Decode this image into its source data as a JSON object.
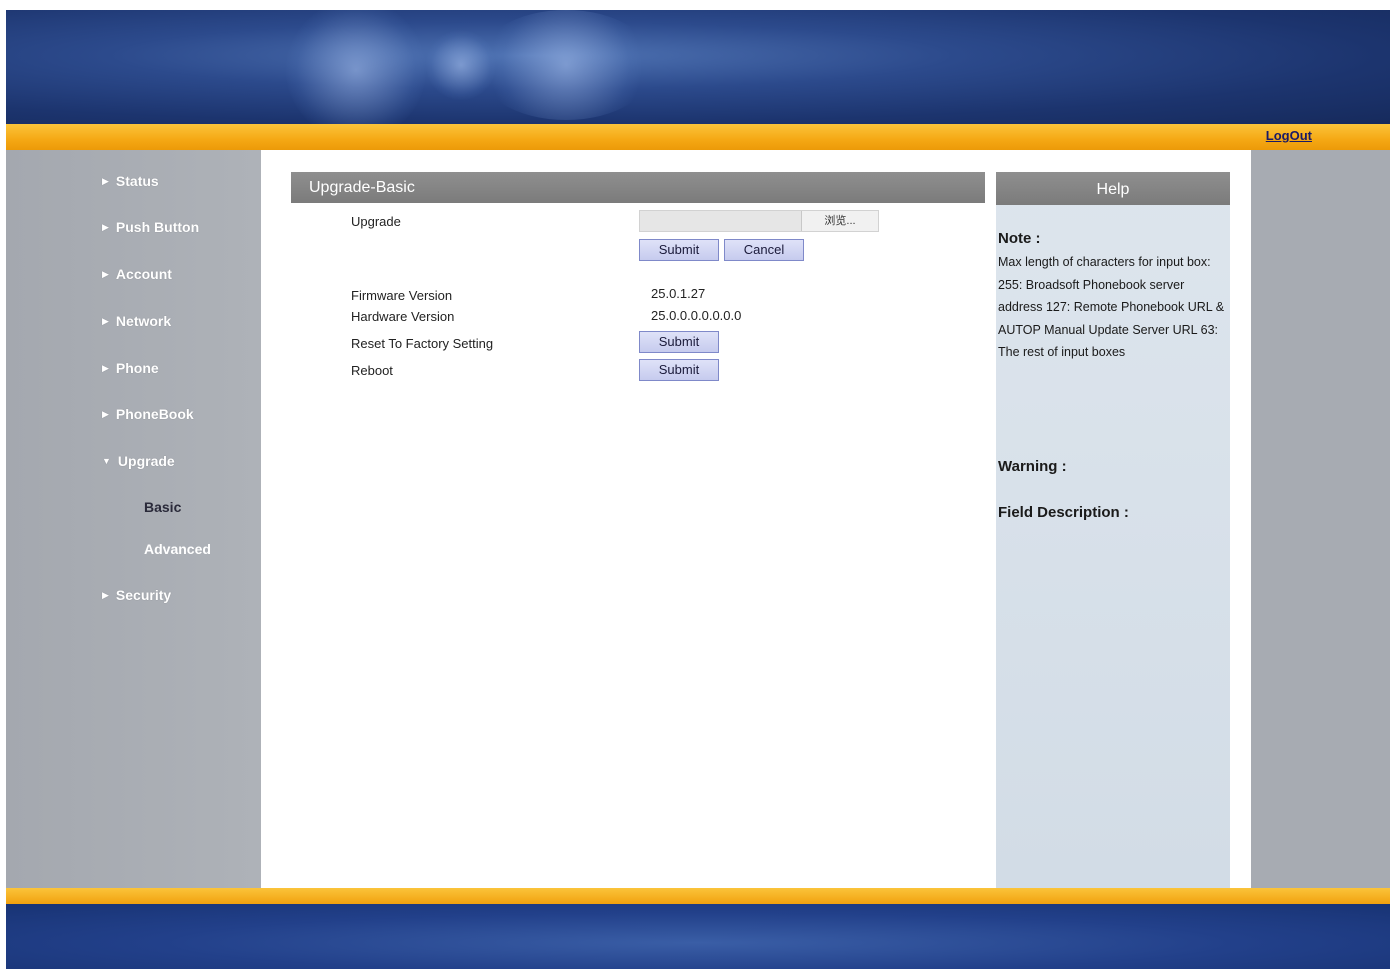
{
  "header": {
    "logout_label": "LogOut"
  },
  "sidebar": {
    "items": [
      {
        "label": "Status"
      },
      {
        "label": "Push Button"
      },
      {
        "label": "Account"
      },
      {
        "label": "Network"
      },
      {
        "label": "Phone"
      },
      {
        "label": "PhoneBook"
      },
      {
        "label": "Upgrade",
        "expanded": true
      },
      {
        "label": "Security"
      }
    ],
    "sub_items": [
      {
        "label": "Basic",
        "active": true
      },
      {
        "label": "Advanced",
        "active": false
      }
    ],
    "collapsed_arrow": "▶",
    "expanded_arrow": "▼"
  },
  "main": {
    "section_title": "Upgrade-Basic",
    "upgrade_label": "Upgrade",
    "browse_label": "浏览...",
    "submit_label": "Submit",
    "cancel_label": "Cancel",
    "firmware_label": "Firmware Version",
    "firmware_value": "25.0.1.27",
    "hardware_label": "Hardware Version",
    "hardware_value": "25.0.0.0.0.0.0.0",
    "reset_label": "Reset To Factory Setting",
    "reset_button": "Submit",
    "reboot_label": "Reboot",
    "reboot_button": "Submit"
  },
  "help": {
    "title": "Help",
    "note_title": "Note :",
    "note_text": "Max length of characters for input box: 255: Broadsoft Phonebook server address 127: Remote Phonebook URL & AUTOP Manual Update Server URL 63: The rest of input boxes",
    "warning_title": "Warning :",
    "field_description_title": "Field Description :"
  },
  "colors": {
    "orange_bar": "#f5a814",
    "header_blue": "#2c4a8c",
    "sidebar_gray": "#a7abb2",
    "section_header_gray": "#808080",
    "help_bg": "#d7e0ea",
    "button_bg": "#cfd4f2"
  }
}
